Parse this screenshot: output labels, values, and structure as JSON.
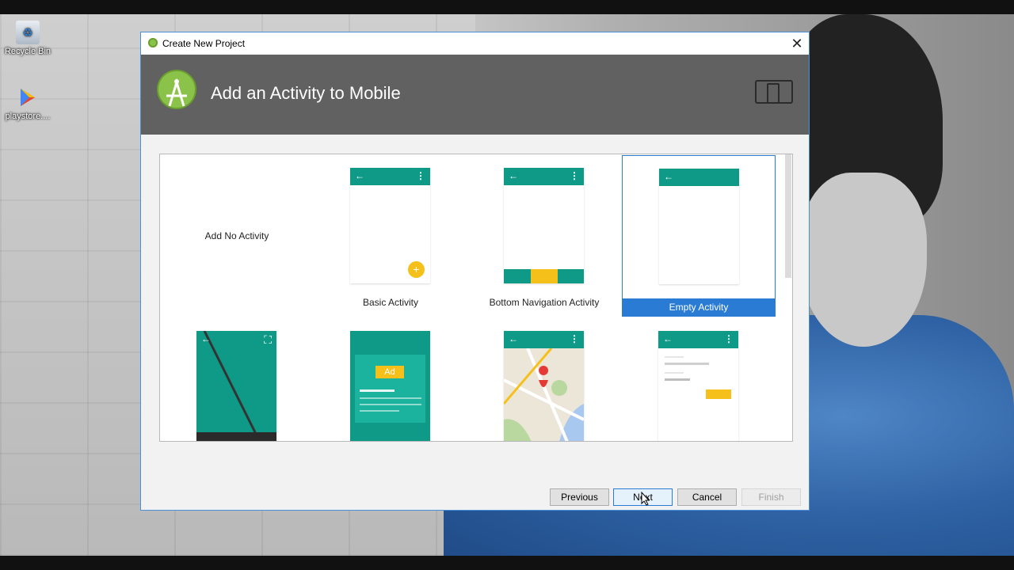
{
  "desktop": {
    "icons": [
      {
        "label": "Recycle Bin",
        "icon": "recycle-bin-icon"
      },
      {
        "label": "playstore....",
        "icon": "play-store-icon"
      }
    ]
  },
  "dialog": {
    "title": "Create New Project",
    "close_glyph": "✕",
    "heading": "Add an Activity to Mobile",
    "templates": [
      {
        "label": "Add No Activity"
      },
      {
        "label": "Basic Activity"
      },
      {
        "label": "Bottom Navigation Activity"
      },
      {
        "label": "Empty Activity",
        "selected": true
      },
      {
        "label": ""
      },
      {
        "label": "",
        "ad_text": "Ad"
      },
      {
        "label": ""
      },
      {
        "label": ""
      }
    ],
    "buttons": {
      "previous": "Previous",
      "next": "Next",
      "cancel": "Cancel",
      "finish": "Finish"
    }
  },
  "colors": {
    "accent": "#2a7bd4",
    "teal": "#0e9a86",
    "amber": "#f5c01a",
    "header": "#616161"
  }
}
